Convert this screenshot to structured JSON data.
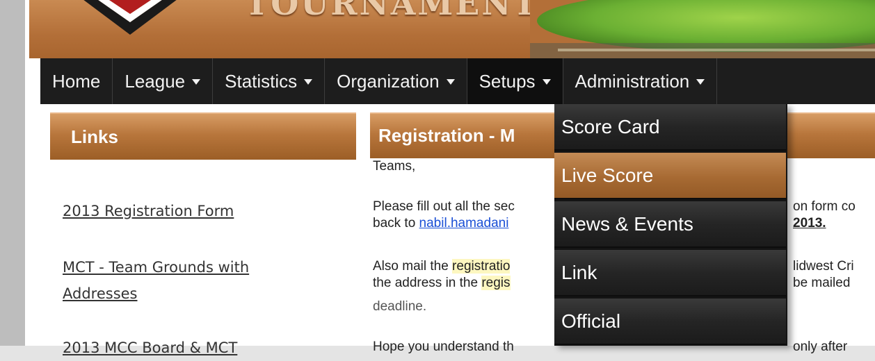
{
  "banner": {
    "title_fragment": "TOURNAMENT"
  },
  "nav": {
    "items": [
      {
        "label": "Home",
        "has_caret": false
      },
      {
        "label": "League",
        "has_caret": true
      },
      {
        "label": "Statistics",
        "has_caret": true
      },
      {
        "label": "Organization",
        "has_caret": true
      },
      {
        "label": "Setups",
        "has_caret": true
      },
      {
        "label": "Administration",
        "has_caret": true
      }
    ]
  },
  "links_panel": {
    "title": "Links",
    "items": [
      "2013 Registration Form",
      "MCT - Team Grounds with",
      "Addresses",
      "2013 MCC Board & MCT"
    ]
  },
  "registration": {
    "title": "Registration - M",
    "greeting": "Teams,",
    "p1_line1": "Please fill out all the sec",
    "p1_line2_prefix": "back to ",
    "p1_email": "nabil.hamadani",
    "p1_r1": "on form co",
    "p1_r2": "2013.",
    "p2_line1_a": "Also mail the ",
    "p2_line1_hl": "registratio",
    "p2_line2_a": "the address in the ",
    "p2_line2_hl": "regis",
    "p2_line3": "deadline.",
    "p2_r1": "lidwest Cri",
    "p2_r2": "be mailed",
    "p3_line1": "Hope you understand th",
    "p3_r1": "only after"
  },
  "dropdown": {
    "items": [
      "Score Card",
      "Live Score",
      "News & Events",
      "Link",
      "Official"
    ],
    "hovered_index": 1
  },
  "colors": {
    "nav_bg": "#1d1d1d",
    "accent_brown": "#b8763c",
    "link_blue": "#1a4fd6"
  }
}
